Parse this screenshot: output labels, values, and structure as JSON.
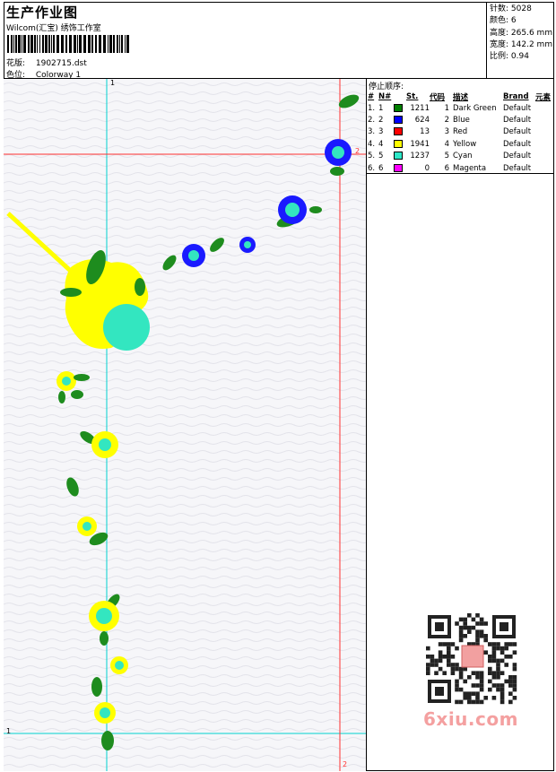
{
  "header": {
    "title": "生产作业图",
    "company": "Wilcom(汇宝) 绣饰工作室",
    "design_label": "花版:",
    "design_file": "1902715.dst",
    "colorway_label": "色位:",
    "colorway": "Colorway 1"
  },
  "stats": [
    {
      "label": "针数:",
      "value": "5028"
    },
    {
      "label": "颜色:",
      "value": "6"
    },
    {
      "label": "高度:",
      "value": "265.6 mm"
    },
    {
      "label": "宽度:",
      "value": "142.2 mm"
    },
    {
      "label": "比例:",
      "value": "0.94"
    }
  ],
  "stop_sequence": {
    "title": "停止顺序:",
    "headers": [
      "#",
      "N#",
      "St.",
      "代码",
      "描述",
      "Brand",
      "元素"
    ],
    "rows": [
      {
        "idx": "1.",
        "n": "1",
        "color": "#008000",
        "stitches": "1211",
        "code": "1",
        "desc": "Dark Green",
        "brand": "Default"
      },
      {
        "idx": "2.",
        "n": "2",
        "color": "#0000ff",
        "stitches": "624",
        "code": "2",
        "desc": "Blue",
        "brand": "Default"
      },
      {
        "idx": "3.",
        "n": "3",
        "color": "#ff0000",
        "stitches": "13",
        "code": "3",
        "desc": "Red",
        "brand": "Default"
      },
      {
        "idx": "4.",
        "n": "4",
        "color": "#ffff00",
        "stitches": "1941",
        "code": "4",
        "desc": "Yellow",
        "brand": "Default"
      },
      {
        "idx": "5.",
        "n": "5",
        "color": "#2ee8c8",
        "stitches": "1237",
        "code": "5",
        "desc": "Cyan",
        "brand": "Default"
      },
      {
        "idx": "6.",
        "n": "6",
        "color": "#ff00ff",
        "stitches": "0",
        "code": "6",
        "desc": "Magenta",
        "brand": "Default"
      }
    ]
  },
  "guides": {
    "v_top": "1",
    "h_left": "1",
    "h_right": "2",
    "v_bottom": "2"
  },
  "watermark": "6xiu.com",
  "colors": {
    "green": "#1e8c1e",
    "blue": "#1a1aff",
    "yellow": "#ffff00",
    "cyan": "#33e6c0",
    "guide_cyan": "#00d0d0",
    "guide_red": "#ff3030"
  }
}
